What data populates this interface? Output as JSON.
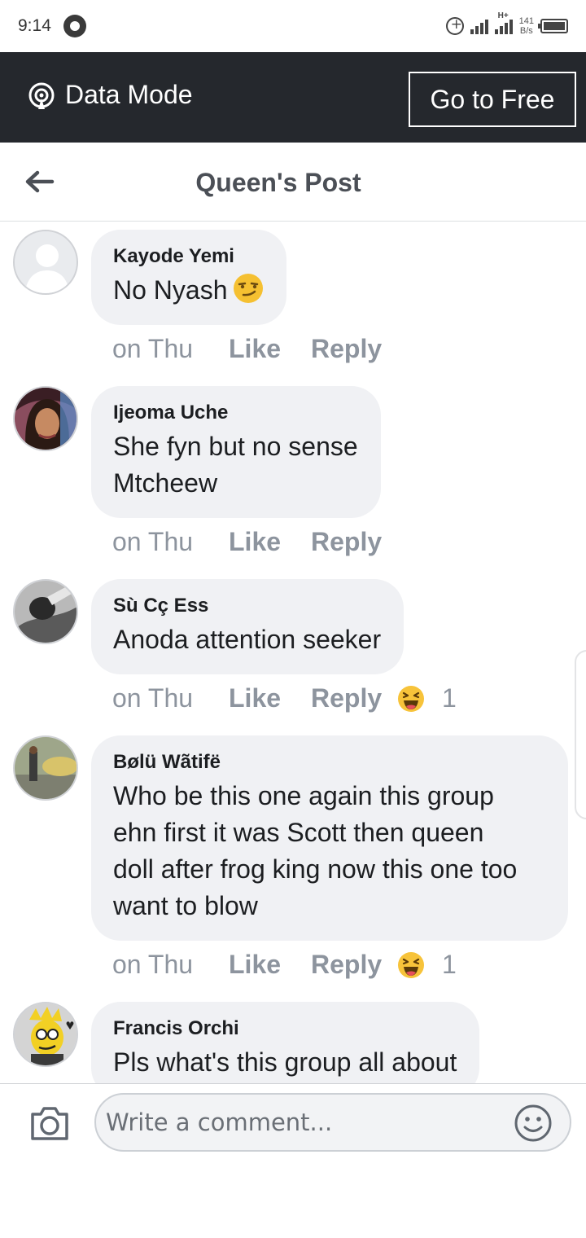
{
  "status_bar": {
    "time": "9:14",
    "network": "H+",
    "speed_value": "141",
    "speed_unit": "B/s",
    "icons": [
      "whatsapp-icon",
      "data-saver-icon",
      "signal-icon",
      "signal-icon",
      "battery-icon"
    ]
  },
  "banner": {
    "mode_label": "Data Mode",
    "button_label": "Go to Free",
    "icon": "broadcast-icon",
    "background": "#25282d"
  },
  "header": {
    "title": "Queen's Post",
    "back_icon": "arrow-left-icon"
  },
  "comments": [
    {
      "name": "Kayode Yemi",
      "lines": [
        "No Nyash"
      ],
      "emoji": "smirk-emoji",
      "time": "on Thu",
      "like": "Like",
      "reply": "Reply"
    },
    {
      "name": "Ijeoma Uche",
      "lines": [
        "She fyn but no sense",
        "Mtcheew"
      ],
      "time": "on Thu",
      "like": "Like",
      "reply": "Reply"
    },
    {
      "name": "Sù Cç Ess",
      "lines": [
        "Anoda attention seeker"
      ],
      "time": "on Thu",
      "like": "Like",
      "reply": "Reply",
      "reaction": "haha-emoji",
      "reaction_count": "1"
    },
    {
      "name": "Bølü Wãtifë",
      "lines": [
        "Who be this one again this group",
        "ehn first it was Scott then queen",
        "doll after frog king now this one too",
        "want to blow"
      ],
      "time": "on Thu",
      "like": "Like",
      "reply": "Reply",
      "reaction": "haha-emoji",
      "reaction_count": "1"
    },
    {
      "name": "Francis Orchi",
      "lines": [
        "Pls what's this group all about"
      ]
    }
  ],
  "composer": {
    "placeholder": "Write a comment...",
    "camera_icon": "camera-icon",
    "emoji_icon": "smiley-icon"
  },
  "colors": {
    "bubble": "#f0f1f4",
    "meta_text": "#8d949e",
    "title_text": "#4b4f56"
  }
}
